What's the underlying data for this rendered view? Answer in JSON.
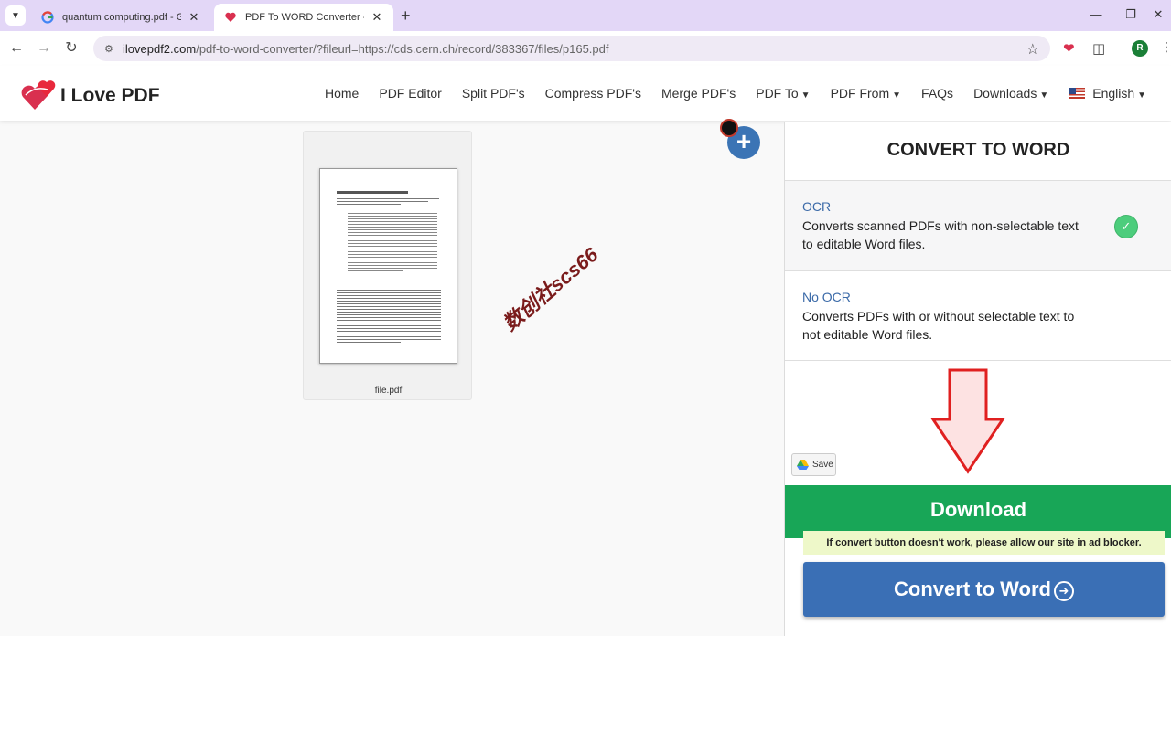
{
  "browser": {
    "tabs": [
      {
        "title": "quantum computing.pdf - Goog",
        "favicon": "google-icon",
        "active": false
      },
      {
        "title": "PDF To WORD Converter - I Lov",
        "favicon": "heart-logo-icon",
        "active": true
      }
    ],
    "url_host": "ilovepdf2.com",
    "url_rest": "/pdf-to-word-converter/?fileurl=https://cds.cern.ch/record/383367/files/p165.pdf",
    "profile_initial": "R"
  },
  "site": {
    "logo_text": "I Love PDF",
    "nav": {
      "home": "Home",
      "pdf_editor": "PDF Editor",
      "split": "Split PDF's",
      "compress": "Compress PDF's",
      "merge": "Merge PDF's",
      "pdf_to": "PDF To",
      "pdf_from": "PDF From",
      "faqs": "FAQs",
      "downloads": "Downloads",
      "language": "English"
    }
  },
  "preview": {
    "file_name": "file.pdf"
  },
  "watermark": "数创社scs66",
  "panel": {
    "title": "CONVERT TO WORD",
    "options": [
      {
        "name": "OCR",
        "description": "Converts scanned PDFs with non-selectable text to editable Word files.",
        "selected": true
      },
      {
        "name": "No OCR",
        "description": "Converts PDFs with or without selectable text to not editable Word files.",
        "selected": false
      }
    ],
    "save_label": "Save",
    "download_label": "Download",
    "notice": "If convert button doesn't work, please allow our site in ad blocker.",
    "convert_label": "Convert to Word"
  },
  "colors": {
    "accent_blue": "#3a6fb5",
    "download_green": "#18a657",
    "check_green": "#4ccd7c",
    "arrow_red": "#e02020"
  }
}
